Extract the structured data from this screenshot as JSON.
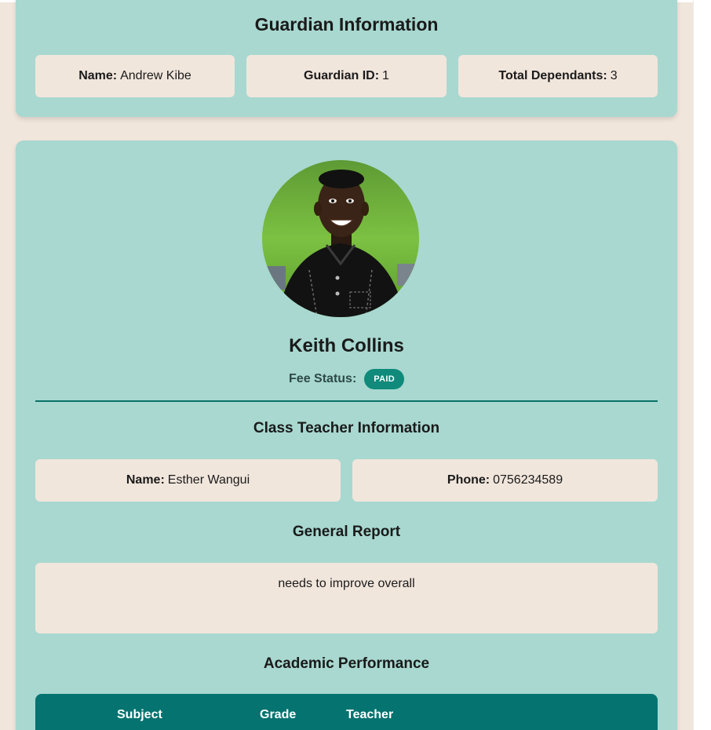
{
  "guardian": {
    "title": "Guardian Information",
    "name_label": "Name:",
    "name_value": "Andrew Kibe",
    "id_label": "Guardian ID:",
    "id_value": "1",
    "dependants_label": "Total Dependants:",
    "dependants_value": "3"
  },
  "student": {
    "name": "Keith Collins",
    "fee_status_label": "Fee Status:",
    "fee_status": "PAID"
  },
  "teacher": {
    "title": "Class Teacher Information",
    "name_label": "Name:",
    "name_value": "Esther Wangui",
    "phone_label": "Phone:",
    "phone_value": "0756234589"
  },
  "report": {
    "title": "General Report",
    "text": "needs to improve overall"
  },
  "performance": {
    "title": "Academic Performance",
    "columns": [
      "Subject",
      "Grade",
      "Teacher"
    ]
  },
  "colors": {
    "page_bg": "#f1e6dc",
    "card_bg": "#a8d8d0",
    "accent": "#057370",
    "badge": "#0f8a7b"
  },
  "icons": {
    "avatar": "student-photo"
  }
}
